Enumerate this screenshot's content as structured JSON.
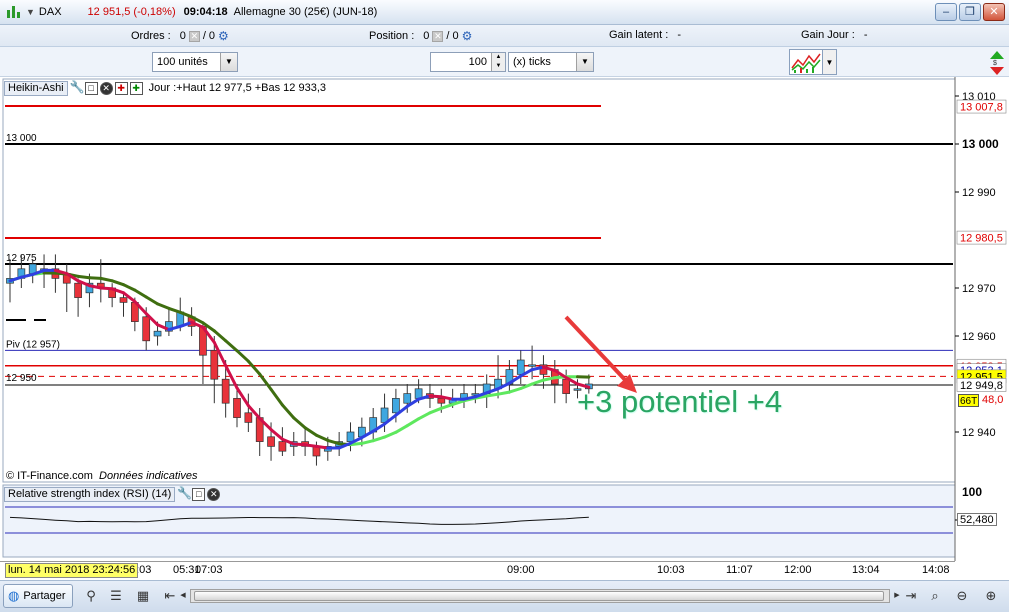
{
  "window": {
    "symbol": "DAX",
    "price_change": "12 951,5 (-0,18%)",
    "time": "09:04:18",
    "instrument": "Allemagne 30 (25€) (JUN-18)",
    "controls": [
      "–",
      "❐",
      "✕"
    ]
  },
  "order_bar": {
    "orders_label": "Ordres :",
    "orders_a": "0",
    "orders_b": "0",
    "position_label": "Position :",
    "position_a": "0",
    "position_b": "0",
    "latent_label": "Gain latent :",
    "latent_value": "-",
    "day_label": "Gain Jour :",
    "day_value": "-"
  },
  "toolbar": {
    "units_select": "100 unités",
    "qty_value": "100",
    "ticks_select": "(x) ticks"
  },
  "main_panel": {
    "tag": "Heikin-Ashi",
    "info": "Jour :+Haut 12 977,5 +Bas 12 933,3",
    "credit": "© IT-Finance.com",
    "credit_note": "Données indicatives",
    "level_labels": [
      {
        "text": "13 000",
        "price": 13000
      },
      {
        "text": "12 975",
        "price": 12975
      },
      {
        "text": "Piv (12 957)",
        "price": 12957
      },
      {
        "text": "12 950",
        "price": 12950
      }
    ],
    "price_axis": [
      {
        "text": "13 010",
        "price": 13010,
        "bold": false
      },
      {
        "text": "13 000",
        "price": 13000,
        "bold": true
      },
      {
        "text": "12 990",
        "price": 12990,
        "bold": false
      },
      {
        "text": "12 970",
        "price": 12970,
        "bold": false
      },
      {
        "text": "12 960",
        "price": 12960,
        "bold": false
      },
      {
        "text": "12 940",
        "price": 12940,
        "bold": false
      }
    ],
    "price_tags": [
      {
        "text": "13 007,8",
        "price": 13007.8,
        "color": "#e00000",
        "bg": "#ffffff"
      },
      {
        "text": "12 980,5",
        "price": 12980.5,
        "color": "#e00000",
        "bg": "#ffffff"
      },
      {
        "text": "12 953,5",
        "price": 12953.8,
        "color": "#e00000",
        "bg": "#ffffff"
      },
      {
        "text": "12 953,1",
        "price": 12952.9,
        "color": "#0000aa",
        "bg": "#ffffff"
      },
      {
        "text": "12 951,5",
        "price": 12951.6,
        "color": "#000000",
        "bg": "#ffff00"
      },
      {
        "text": "12 949,8",
        "price": 12949.8,
        "color": "#000000",
        "bg": "#ffffff"
      }
    ],
    "countdown": "66T",
    "countdown_value": "48,0",
    "annotation": "+3 potentiel +4"
  },
  "rsi_panel": {
    "tag": "Relative strength index (RSI) (14)",
    "axis_top": "100",
    "value": "52,480"
  },
  "time_axis": {
    "selected_date": "lun. 14 mai 2018 23:24:56",
    "labels": [
      "4:03",
      "05:31",
      "07:03",
      "09:00",
      "10:03",
      "11:07",
      "12:00",
      "13:04",
      "14:08"
    ]
  },
  "bottom_bar": {
    "share_label": "Partager"
  },
  "colors": {
    "bull_candle": "#3fa7e0",
    "bear_candle": "#e8323a",
    "ma_fast_up": "#2f3fe0",
    "ma_fast_down": "#d0104a",
    "ma_slow_up": "#5ee85e",
    "ma_slow_down": "#3f6e10",
    "annotation": "#2aa563"
  },
  "candles": [
    {
      "o": 12971,
      "c": 12972,
      "h": 12976,
      "l": 12967
    },
    {
      "o": 12972,
      "c": 12974,
      "h": 12977,
      "l": 12970
    },
    {
      "o": 12973,
      "c": 12975,
      "h": 12976,
      "l": 12971
    },
    {
      "o": 12974,
      "c": 12974,
      "h": 12977,
      "l": 12970
    },
    {
      "o": 12974,
      "c": 12972,
      "h": 12977,
      "l": 12969
    },
    {
      "o": 12973,
      "c": 12971,
      "h": 12975,
      "l": 12965
    },
    {
      "o": 12971,
      "c": 12968,
      "h": 12972,
      "l": 12964
    },
    {
      "o": 12969,
      "c": 12971,
      "h": 12973,
      "l": 12966
    },
    {
      "o": 12971,
      "c": 12970,
      "h": 12976,
      "l": 12967
    },
    {
      "o": 12970,
      "c": 12968,
      "h": 12971,
      "l": 12966
    },
    {
      "o": 12968,
      "c": 12967,
      "h": 12969,
      "l": 12964
    },
    {
      "o": 12967,
      "c": 12963,
      "h": 12968,
      "l": 12961
    },
    {
      "o": 12964,
      "c": 12959,
      "h": 12966,
      "l": 12957
    },
    {
      "o": 12960,
      "c": 12961,
      "h": 12963,
      "l": 12958
    },
    {
      "o": 12961,
      "c": 12963,
      "h": 12966,
      "l": 12960
    },
    {
      "o": 12962,
      "c": 12965,
      "h": 12968,
      "l": 12961
    },
    {
      "o": 12964,
      "c": 12962,
      "h": 12966,
      "l": 12960
    },
    {
      "o": 12962,
      "c": 12956,
      "h": 12963,
      "l": 12950
    },
    {
      "o": 12957,
      "c": 12951,
      "h": 12960,
      "l": 12946
    },
    {
      "o": 12951,
      "c": 12946,
      "h": 12955,
      "l": 12943
    },
    {
      "o": 12947,
      "c": 12943,
      "h": 12950,
      "l": 12941
    },
    {
      "o": 12944,
      "c": 12942,
      "h": 12948,
      "l": 12940
    },
    {
      "o": 12943,
      "c": 12938,
      "h": 12945,
      "l": 12935
    },
    {
      "o": 12939,
      "c": 12937,
      "h": 12942,
      "l": 12934
    },
    {
      "o": 12938,
      "c": 12936,
      "h": 12941,
      "l": 12935
    },
    {
      "o": 12937,
      "c": 12938,
      "h": 12940,
      "l": 12935
    },
    {
      "o": 12938,
      "c": 12937,
      "h": 12941,
      "l": 12935
    },
    {
      "o": 12937,
      "c": 12935,
      "h": 12938,
      "l": 12933
    },
    {
      "o": 12936,
      "c": 12937,
      "h": 12939,
      "l": 12934
    },
    {
      "o": 12937,
      "c": 12938,
      "h": 12940,
      "l": 12935
    },
    {
      "o": 12938,
      "c": 12940,
      "h": 12942,
      "l": 12936
    },
    {
      "o": 12939,
      "c": 12941,
      "h": 12943,
      "l": 12937
    },
    {
      "o": 12940,
      "c": 12943,
      "h": 12945,
      "l": 12938
    },
    {
      "o": 12942,
      "c": 12945,
      "h": 12948,
      "l": 12940
    },
    {
      "o": 12944,
      "c": 12947,
      "h": 12949,
      "l": 12942
    },
    {
      "o": 12946,
      "c": 12948,
      "h": 12950,
      "l": 12944
    },
    {
      "o": 12947,
      "c": 12949,
      "h": 12951,
      "l": 12946
    },
    {
      "o": 12948,
      "c": 12947,
      "h": 12950,
      "l": 12945
    },
    {
      "o": 12947,
      "c": 12946,
      "h": 12949,
      "l": 12944
    },
    {
      "o": 12946,
      "c": 12947,
      "h": 12949,
      "l": 12945
    },
    {
      "o": 12947,
      "c": 12948,
      "h": 12950,
      "l": 12945
    },
    {
      "o": 12948,
      "c": 12948,
      "h": 12950,
      "l": 12946
    },
    {
      "o": 12948,
      "c": 12950,
      "h": 12952,
      "l": 12945
    },
    {
      "o": 12949,
      "c": 12951,
      "h": 12956,
      "l": 12947
    },
    {
      "o": 12950,
      "c": 12953,
      "h": 12955,
      "l": 12948
    },
    {
      "o": 12952,
      "c": 12955,
      "h": 12957,
      "l": 12950
    },
    {
      "o": 12954,
      "c": 12954,
      "h": 12958,
      "l": 12951
    },
    {
      "o": 12954,
      "c": 12952,
      "h": 12956,
      "l": 12949
    },
    {
      "o": 12953,
      "c": 12950,
      "h": 12955,
      "l": 12946
    },
    {
      "o": 12951,
      "c": 12948,
      "h": 12953,
      "l": 12946
    },
    {
      "o": 12949,
      "c": 12949,
      "h": 12951,
      "l": 12947
    },
    {
      "o": 12949,
      "c": 12950,
      "h": 12952,
      "l": 12948
    }
  ]
}
